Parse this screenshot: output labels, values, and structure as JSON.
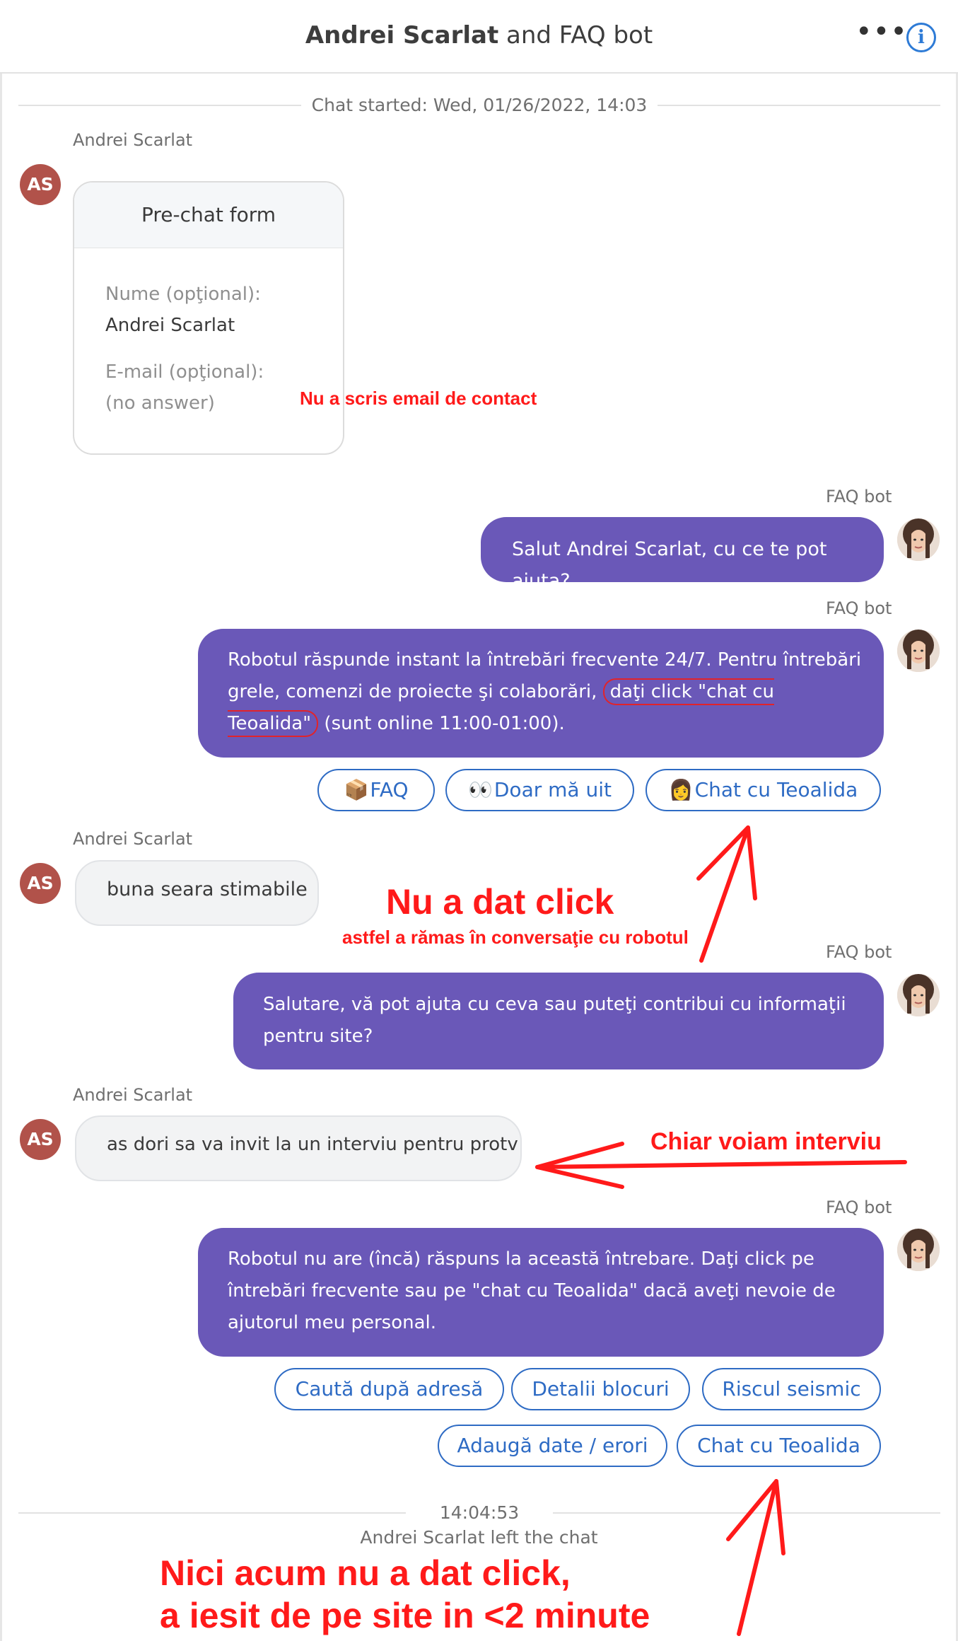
{
  "header": {
    "title_part1": "Andrei Scarlat",
    "title_part2": " and ",
    "title_part3": "FAQ bot",
    "more_icon": "•••",
    "info_icon": "i"
  },
  "chat_started": "Chat started: Wed, 01/26/2022, 14:03",
  "user": {
    "name": "Andrei Scarlat",
    "initials": "AS"
  },
  "bot": {
    "name": "FAQ bot"
  },
  "prechat": {
    "title": "Pre-chat form",
    "name_label": "Nume (opţional):",
    "name_value": "Andrei Scarlat",
    "email_label": "E-mail (opţional):",
    "email_value": "(no answer)"
  },
  "messages": {
    "bot1": "Salut Andrei Scarlat, cu ce te pot ajuta?",
    "bot2_part1": "Robotul răspunde instant la întrebări frecvente 24/7. Pentru întrebări grele, comenzi de proiecte şi colaborări, ",
    "bot2_highlight": "daţi click \"chat cu Teoalida\"",
    "bot2_part2": " (sunt online 11:00-01:00).",
    "user1": "buna seara stimabile",
    "bot3": "Salutare, vă pot ajuta cu ceva sau puteţi contribui cu informaţii pentru site?",
    "user2": "as dori sa va invit la un interviu pentru protv",
    "bot4": "Robotul nu are (încă) răspuns la această întrebare. Daţi click pe întrebări frecvente sau pe \"chat cu Teoalida\" dacă aveţi nevoie de ajutorul meu personal."
  },
  "quick_replies_1": {
    "faq": {
      "emoji": "📦",
      "label": "FAQ"
    },
    "look": {
      "emoji": "👀",
      "label": "Doar mă uit"
    },
    "chat": {
      "emoji": "👩",
      "label": "Chat cu Teoalida"
    }
  },
  "quick_replies_2": {
    "address": "Caută după adresă",
    "blocks": "Detalii blocuri",
    "seismic": "Riscul seismic",
    "add_data": "Adaugă date / erori",
    "chat": "Chat cu Teoalida"
  },
  "end": {
    "time": "14:04:53",
    "left_text": "Andrei Scarlat left the chat"
  },
  "annotations": {
    "email": "Nu a scris email de contact",
    "no_click_title": "Nu a dat click",
    "no_click_sub": "astfel a rămas în conversaţie cu robotul",
    "interview": "Chiar voiam interviu",
    "final_line1": "Nici acum nu a dat click,",
    "final_line2": "a iesit de pe site in <2 minute",
    "color": "#ff1a1a"
  },
  "colors": {
    "bot_bubble": "#6a58b8",
    "user_avatar": "#b1524a",
    "chip_border": "#2e6bc4"
  }
}
